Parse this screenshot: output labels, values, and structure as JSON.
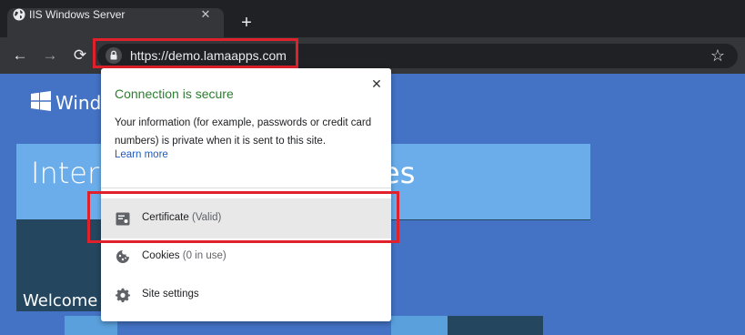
{
  "browser": {
    "tab": {
      "title": "IIS Windows Server",
      "icon": "globe-icon",
      "close_glyph": "✕"
    },
    "new_tab_glyph": "+",
    "nav": {
      "back_glyph": "←",
      "forward_glyph": "→",
      "reload_glyph": "⟳",
      "star_glyph": "☆"
    },
    "address": {
      "url": "https://demo.lamaapps.com",
      "icon": "lock-icon"
    }
  },
  "page": {
    "brand_text": "Windo",
    "tile_text_left": "Intern",
    "tile_text_right": "es",
    "welcome": "Welcome"
  },
  "popup": {
    "close_glyph": "✕",
    "title": "Connection is secure",
    "info": "Your information (for example, passwords or credit card numbers) is private when it is sent to this site.",
    "learn_more": "Learn more",
    "items": [
      {
        "label": "Certificate",
        "status": "(Valid)",
        "icon": "certificate-icon"
      },
      {
        "label": "Cookies",
        "status": "(0 in use)",
        "icon": "cookie-icon"
      },
      {
        "label": "Site settings",
        "status": "",
        "icon": "gear-icon"
      }
    ]
  },
  "colors": {
    "page_background": "#4472c4",
    "tile_light": "#6aadea",
    "tile_dark": "#24465e",
    "secure_green": "#2e7d32",
    "link_blue": "#1a5bc4",
    "highlight_red": "#e0202a"
  }
}
